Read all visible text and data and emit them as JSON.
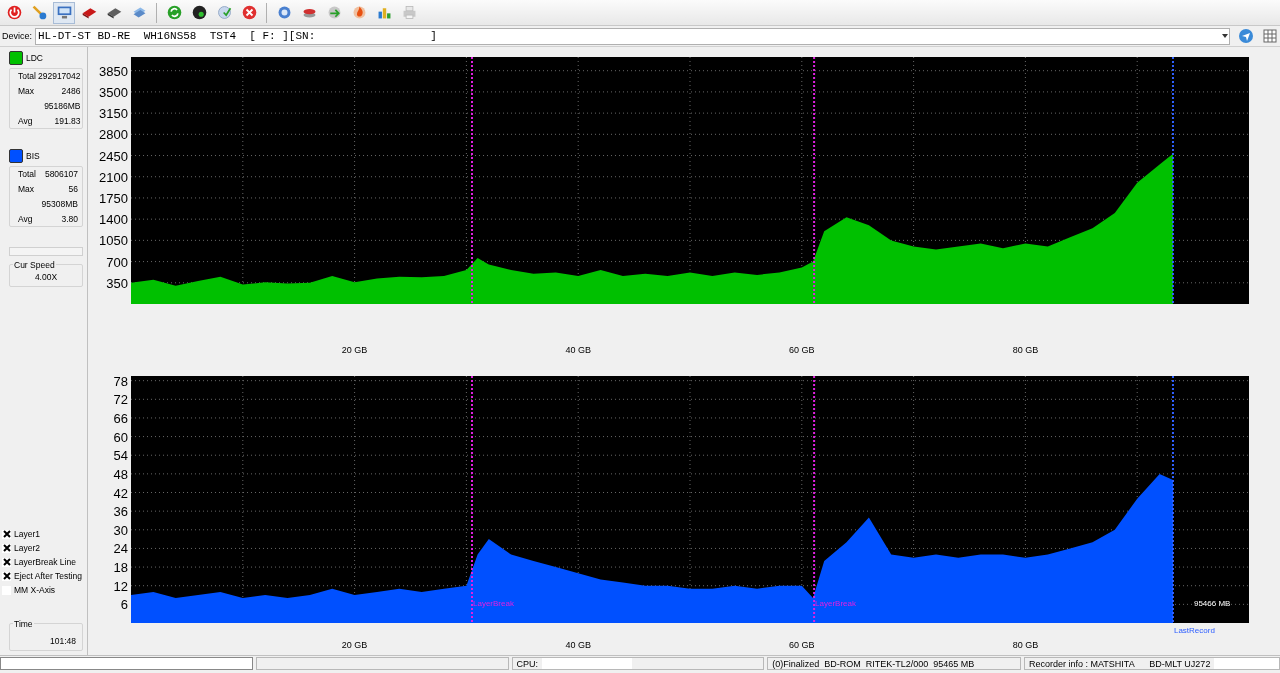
{
  "toolbar": [
    {
      "kind": "power",
      "selected": false
    },
    {
      "kind": "wand",
      "selected": false
    },
    {
      "kind": "monitor",
      "selected": true
    },
    {
      "kind": "card",
      "selected": false
    },
    {
      "kind": "drive",
      "selected": false
    },
    {
      "kind": "scanner",
      "selected": false
    },
    {
      "kind": "separator"
    },
    {
      "kind": "refresh",
      "selected": false
    },
    {
      "kind": "disc",
      "selected": false
    },
    {
      "kind": "disc-check",
      "selected": false
    },
    {
      "kind": "close",
      "selected": false
    },
    {
      "kind": "separator"
    },
    {
      "kind": "ring",
      "selected": false
    },
    {
      "kind": "disc-stack",
      "selected": false
    },
    {
      "kind": "disc-arrow",
      "selected": false
    },
    {
      "kind": "flame",
      "selected": false
    },
    {
      "kind": "bars",
      "selected": false
    },
    {
      "kind": "printer",
      "selected": false
    }
  ],
  "device": {
    "label": "Device:",
    "value": "HL-DT-ST BD-RE  WH16NS58  TST4  [ F: ][SN:",
    "value_end": "]"
  },
  "legend": [
    {
      "stats": [
        {
          "label": "Total",
          "value": "292917042"
        },
        {
          "label": "Max",
          "value": "2486"
        },
        {
          "value": "95186MB"
        },
        {
          "label": "Avg",
          "value": "191.83"
        }
      ]
    },
    {
      "stats": [
        {
          "label": "Total",
          "value": "5806107"
        },
        {
          "label": "Max",
          "value": "56"
        },
        {
          "value": "95308MB"
        },
        {
          "label": "Avg",
          "value": "3.80"
        }
      ]
    }
  ],
  "progress": {
    "level": 0
  },
  "cur_speed": {
    "title": "Cur Speed",
    "value": "4.00X"
  },
  "options": [
    {
      "label": "Layer1",
      "checked": true
    },
    {
      "label": "Layer2",
      "checked": true
    },
    {
      "label": "LayerBreak Line",
      "checked": true
    },
    {
      "label": "Eject After Testing",
      "checked": true
    },
    {
      "label": "MM X-Axis",
      "checked": false
    }
  ],
  "time": {
    "title": "Time",
    "value": "101:48"
  },
  "charts": [
    {
      "chart_data": {
        "type": "area",
        "grid": true,
        "xlim": [
          0,
          100
        ],
        "ylim": [
          0,
          4076
        ],
        "x": [
          0,
          2,
          4,
          6,
          8,
          10,
          12,
          14,
          16,
          18,
          20,
          22,
          24,
          26,
          28,
          30,
          31,
          32,
          34,
          36,
          38,
          40,
          42,
          44,
          46,
          48,
          50,
          52,
          54,
          56,
          58,
          60,
          61,
          62,
          64,
          66,
          68,
          70,
          72,
          74,
          76,
          78,
          80,
          82,
          84,
          86,
          88,
          90,
          92,
          93.2
        ],
        "series": [
          {
            "name": "LDC",
            "color": "#00c000",
            "values": [
              350,
              400,
              300,
              380,
              450,
              320,
              360,
              340,
              350,
              460,
              360,
              420,
              450,
              440,
              460,
              560,
              760,
              650,
              560,
              500,
              520,
              460,
              560,
              460,
              500,
              460,
              520,
              460,
              520,
              480,
              520,
              600,
              700,
              1200,
              1430,
              1300,
              1050,
              950,
              900,
              950,
              1000,
              920,
              1000,
              950,
              1100,
              1250,
              1500,
              2000,
              2300,
              2480
            ]
          }
        ],
        "xticks": [
          {
            "value": 20,
            "label": "20 GB"
          },
          {
            "value": 40,
            "label": "40 GB"
          },
          {
            "value": 60,
            "label": "60 GB"
          },
          {
            "value": 80,
            "label": "80 GB"
          }
        ],
        "yticks": [
          350,
          700,
          1050,
          1400,
          1750,
          2100,
          2450,
          2800,
          3150,
          3500,
          3850
        ],
        "ref_lines": [
          {
            "axis": "x",
            "value": 30.5,
            "color": "#e020e0"
          },
          {
            "axis": "x",
            "value": 61.1,
            "color": "#e020e0"
          },
          {
            "axis": "x",
            "value": 93.2,
            "color": "#3060ff"
          }
        ]
      }
    },
    {
      "chart_data": {
        "type": "area",
        "grid": true,
        "xlim": [
          0,
          100
        ],
        "ylim": [
          0,
          79.5
        ],
        "x": [
          0,
          2,
          4,
          6,
          8,
          10,
          12,
          14,
          16,
          18,
          20,
          22,
          24,
          26,
          28,
          30,
          31,
          32,
          34,
          36,
          38,
          40,
          42,
          44,
          46,
          48,
          50,
          52,
          54,
          56,
          58,
          60,
          61,
          62,
          64,
          66,
          68,
          70,
          72,
          74,
          76,
          78,
          80,
          82,
          84,
          86,
          88,
          90,
          92,
          93.2
        ],
        "series": [
          {
            "name": "BIS",
            "color": "#0050ff",
            "values": [
              9,
              10,
              8,
              9,
              10,
              8,
              9,
              8,
              9,
              11,
              9,
              10,
              11,
              10,
              11,
              12,
              22,
              27,
              22,
              20,
              18,
              16,
              14,
              13,
              12,
              12,
              11,
              11,
              12,
              11,
              12,
              12,
              8,
              20,
              26,
              34,
              22,
              21,
              22,
              21,
              22,
              22,
              21,
              22,
              24,
              26,
              30,
              40,
              48,
              46
            ]
          }
        ],
        "xticks": [
          {
            "value": 20,
            "label": "20 GB"
          },
          {
            "value": 40,
            "label": "40 GB"
          },
          {
            "value": 60,
            "label": "60 GB"
          },
          {
            "value": 80,
            "label": "80 GB"
          }
        ],
        "yticks": [
          6,
          12,
          18,
          24,
          30,
          36,
          42,
          48,
          54,
          60,
          66,
          72,
          78
        ],
        "ref_lines": [
          {
            "axis": "x",
            "value": 30.5,
            "label": "LayerBreak",
            "color": "#e020e0"
          },
          {
            "axis": "x",
            "value": 61.1,
            "label": "LayerBreak",
            "color": "#e020e0"
          },
          {
            "axis": "x",
            "value": 93.2,
            "label": "LastRecord",
            "color": "#3060ff"
          }
        ],
        "annotations": [
          "95466 MB"
        ]
      }
    }
  ],
  "status_bar": [
    {
      "kind": "field"
    },
    {
      "kind": "panel"
    },
    {
      "kind": "panel",
      "text": "CPU:",
      "blank": true
    },
    {
      "kind": "panel",
      "text": "(0)Finalized  BD-ROM  RITEK-TL2/000  95465 MB"
    },
    {
      "kind": "panel",
      "text": "Recorder info : MATSHITA      BD-MLT UJ272",
      "blank": true
    }
  ]
}
